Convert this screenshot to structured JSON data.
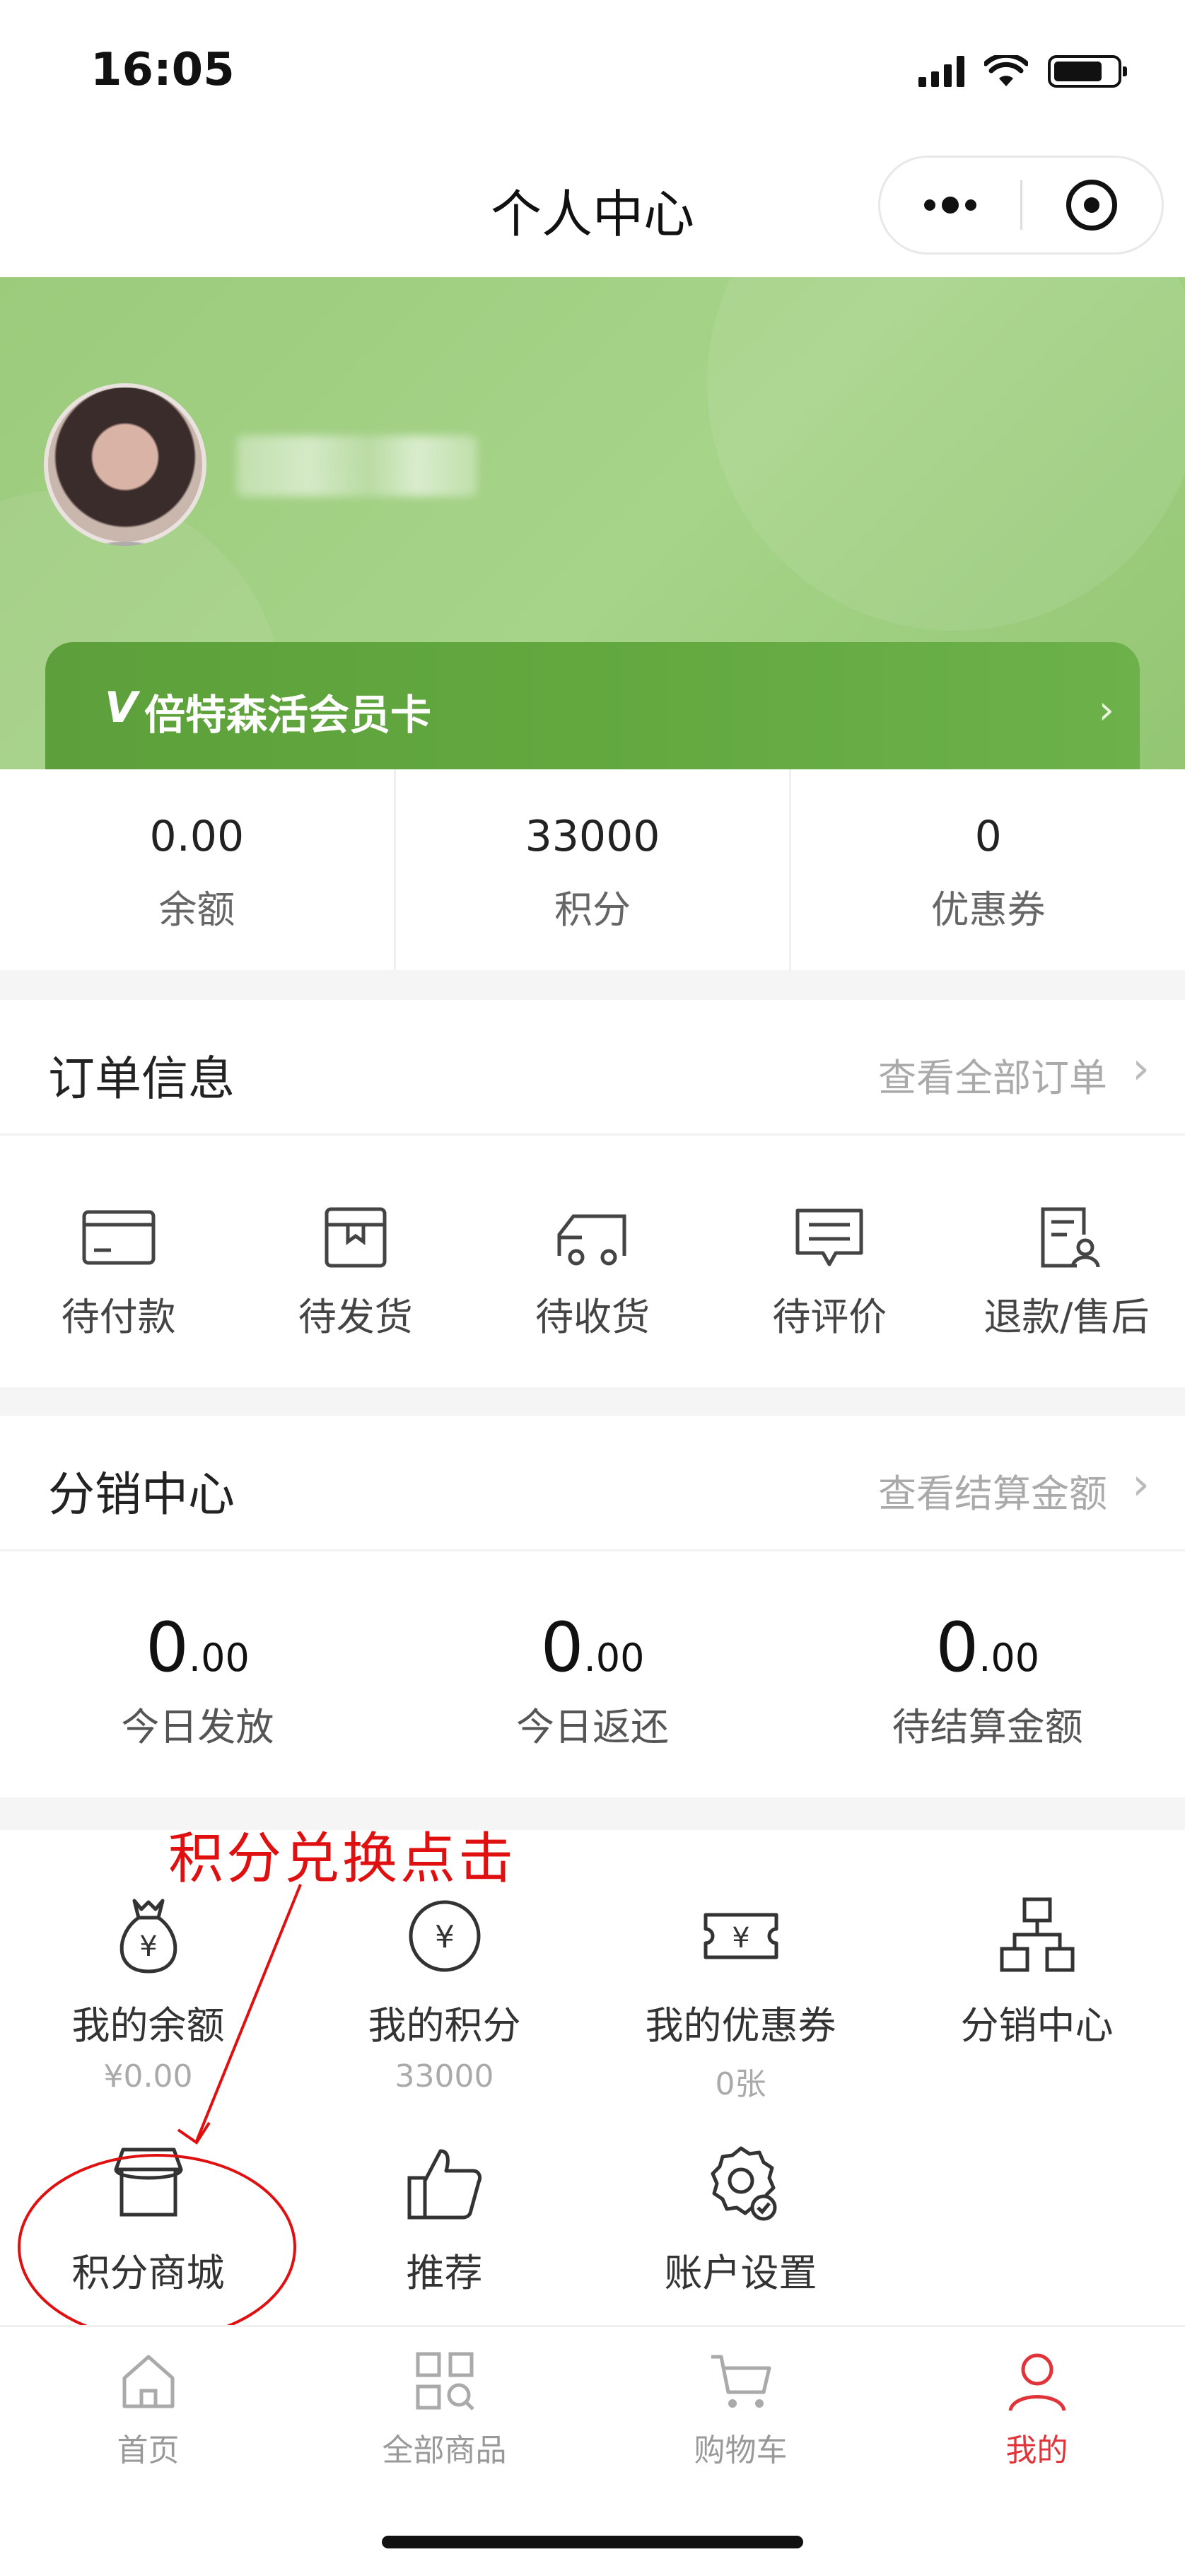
{
  "status_bar": {
    "time": "16:05"
  },
  "nav": {
    "title": "个人中心"
  },
  "profile": {
    "member_card_label": "倍特森活会员卡",
    "member_card_logo": "V"
  },
  "stats": [
    {
      "value": "0.00",
      "label": "余额"
    },
    {
      "value": "33000",
      "label": "积分"
    },
    {
      "value": "0",
      "label": "优惠券"
    }
  ],
  "orders": {
    "title": "订单信息",
    "link": "查看全部订单",
    "items": [
      {
        "label": "待付款",
        "icon": "card-icon"
      },
      {
        "label": "待发货",
        "icon": "box-icon"
      },
      {
        "label": "待收货",
        "icon": "truck-icon"
      },
      {
        "label": "待评价",
        "icon": "comment-icon"
      },
      {
        "label": "退款/售后",
        "icon": "refund-icon"
      }
    ]
  },
  "distribution": {
    "title": "分销中心",
    "link": "查看结算金额",
    "items": [
      {
        "big": "0",
        "small": ".00",
        "label": "今日发放"
      },
      {
        "big": "0",
        "small": ".00",
        "label": "今日返还"
      },
      {
        "big": "0",
        "small": ".00",
        "label": "待结算金额"
      }
    ]
  },
  "annotation": {
    "text": "积分兑换点击"
  },
  "tools": [
    {
      "label": "我的余额",
      "sub": "¥0.00",
      "icon": "money-bag-icon"
    },
    {
      "label": "我的积分",
      "sub": "33000",
      "icon": "yen-circle-icon"
    },
    {
      "label": "我的优惠券",
      "sub": "0张",
      "icon": "coupon-icon"
    },
    {
      "label": "分销中心",
      "sub": "",
      "icon": "hierarchy-icon"
    },
    {
      "label": "积分商城",
      "sub": "",
      "icon": "store-icon"
    },
    {
      "label": "推荐",
      "sub": "",
      "icon": "thumbs-up-icon"
    },
    {
      "label": "账户设置",
      "sub": "",
      "icon": "settings-icon"
    }
  ],
  "tabs": [
    {
      "label": "首页",
      "icon": "home-icon"
    },
    {
      "label": "全部商品",
      "icon": "grid-search-icon"
    },
    {
      "label": "购物车",
      "icon": "cart-icon"
    },
    {
      "label": "我的",
      "icon": "user-icon",
      "active": true
    }
  ],
  "colors": {
    "accent": "#e0343a",
    "header_green": "#9ccb7c",
    "card_green": "#62a83f",
    "annotation_red": "#e01010"
  }
}
